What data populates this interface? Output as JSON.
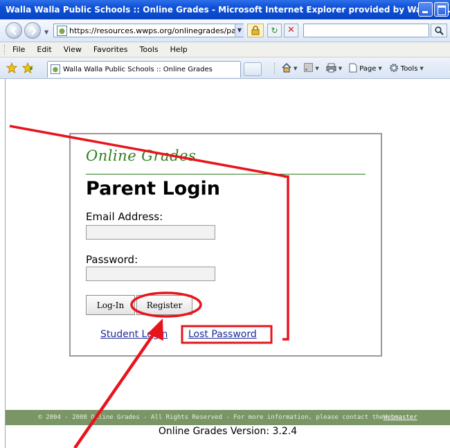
{
  "window": {
    "title": "Walla Walla Public Schools :: Online Grades - Microsoft Internet Explorer provided by Walla W..."
  },
  "address_bar": {
    "url": "https://resources.wwps.org/onlinegrades/parents",
    "search_placeholder": ""
  },
  "menu": [
    "File",
    "Edit",
    "View",
    "Favorites",
    "Tools",
    "Help"
  ],
  "tab": {
    "title": "Walla Walla Public Schools :: Online Grades"
  },
  "command_bar": {
    "page_label": "Page",
    "tools_label": "Tools"
  },
  "login": {
    "brand": "Online Grades",
    "heading": "Parent Login",
    "email_label": "Email Address:",
    "email_value": "",
    "password_label": "Password:",
    "password_value": "",
    "login_button": "Log-In",
    "register_button": "Register",
    "student_link": "Student Login",
    "lost_password_link": "Lost Password"
  },
  "footer": {
    "text": "© 2004 - 2008 Online Grades - All Rights Reserved - For more information, please contact the ",
    "webmaster_link": "Webmaster",
    "version": "Online Grades Version: 3.2.4"
  },
  "colors": {
    "brand_green": "#2e7d1f",
    "footer_bg": "#7a9566",
    "annotation_red": "#e8141c",
    "link_blue": "#1e2a9a"
  }
}
